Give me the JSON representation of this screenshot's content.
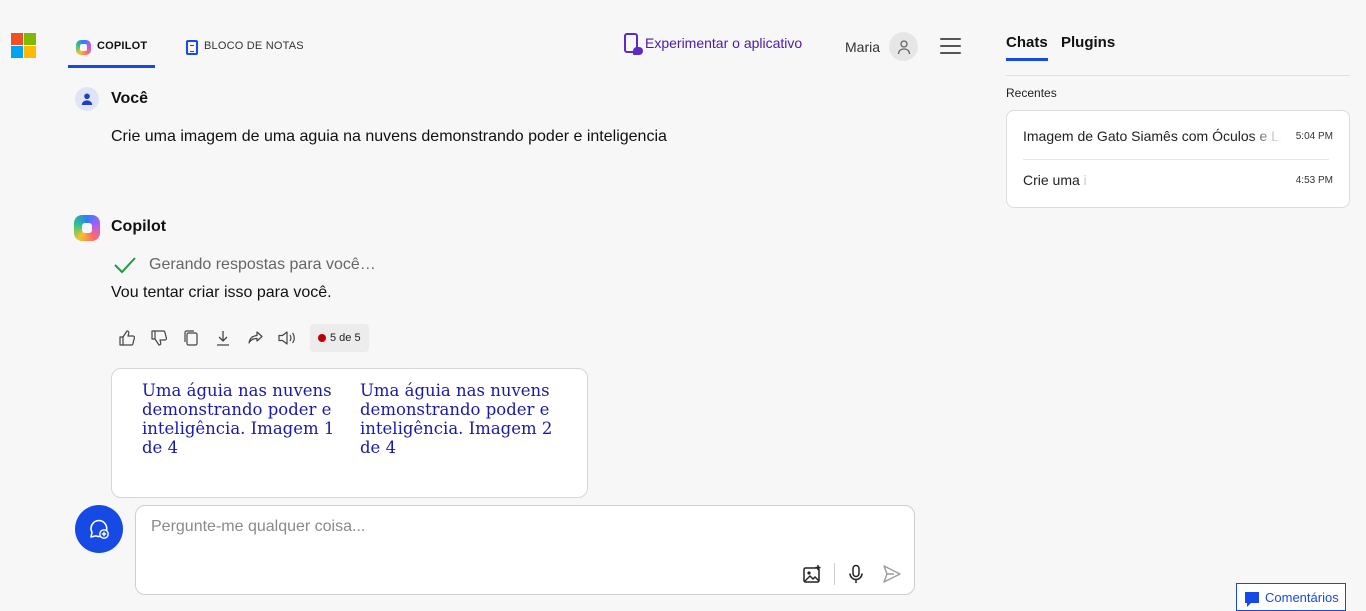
{
  "header": {
    "tabs": [
      {
        "label": "COPILOT",
        "icon": "copilot-icon",
        "active": true
      },
      {
        "label": "BLOCO DE NOTAS",
        "icon": "notebook-icon",
        "active": false
      }
    ],
    "try_app_label": "Experimentar o aplicativo",
    "user_name": "Maria"
  },
  "conversation": {
    "user_speaker": "Você",
    "user_message": "Crie uma imagem de uma aguia na nuvens demonstrando poder e inteligencia",
    "bot_speaker": "Copilot",
    "status_text": "Gerando respostas para você…",
    "bot_message": "Vou tentar criar isso para você.",
    "page_counter": "5 de 5",
    "images": [
      {
        "caption": "Uma águia nas nuvens demonstrando poder e inteligência. Imagem 1 de 4"
      },
      {
        "caption": "Uma águia nas nuvens demonstrando poder e inteligência. Imagem 2 de 4"
      }
    ]
  },
  "composer": {
    "placeholder": "Pergunte-me qualquer coisa..."
  },
  "sidebar": {
    "tabs": [
      {
        "label": "Chats",
        "active": true
      },
      {
        "label": "Plugins",
        "active": false
      }
    ],
    "recent_label": "Recentes",
    "recent_items": [
      {
        "title": "Imagem de Gato Siamês com Óculos e Livro",
        "time": "5:04 PM"
      },
      {
        "title": "Crie uma i",
        "time": "4:53 PM"
      }
    ]
  },
  "feedback_label": "Comentários",
  "colors": {
    "accent": "#174ae4",
    "try_app": "#4b1aa8",
    "link": "#1a1aa8"
  }
}
